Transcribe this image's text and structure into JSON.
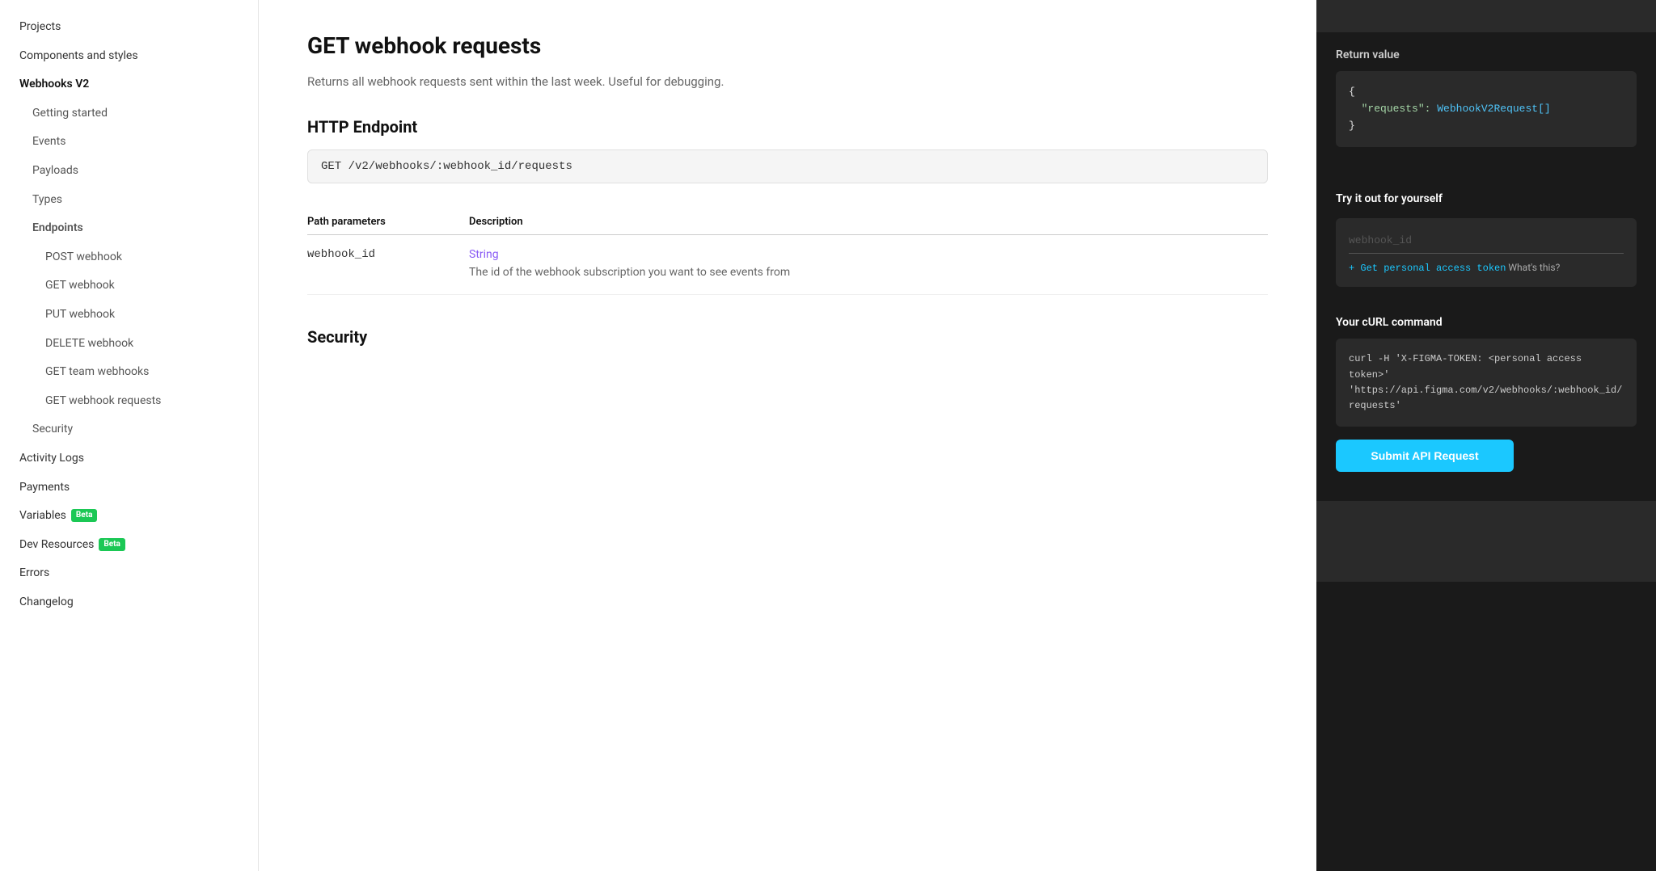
{
  "sidebar": {
    "items": [
      {
        "id": "projects",
        "label": "Projects",
        "level": "top"
      },
      {
        "id": "components-and-styles",
        "label": "Components and styles",
        "level": "top"
      },
      {
        "id": "webhooks-v2",
        "label": "Webhooks V2",
        "level": "top",
        "bold": true
      },
      {
        "id": "getting-started",
        "label": "Getting started",
        "level": "sub"
      },
      {
        "id": "events",
        "label": "Events",
        "level": "sub"
      },
      {
        "id": "payloads",
        "label": "Payloads",
        "level": "sub"
      },
      {
        "id": "types",
        "label": "Types",
        "level": "sub"
      },
      {
        "id": "endpoints",
        "label": "Endpoints",
        "level": "sub",
        "active": true
      },
      {
        "id": "post-webhook",
        "label": "POST webhook",
        "level": "subsub"
      },
      {
        "id": "get-webhook",
        "label": "GET webhook",
        "level": "subsub"
      },
      {
        "id": "put-webhook",
        "label": "PUT webhook",
        "level": "subsub"
      },
      {
        "id": "delete-webhook",
        "label": "DELETE webhook",
        "level": "subsub"
      },
      {
        "id": "get-team-webhooks",
        "label": "GET team webhooks",
        "level": "subsub"
      },
      {
        "id": "get-webhook-requests",
        "label": "GET webhook requests",
        "level": "subsub",
        "active": false
      },
      {
        "id": "security",
        "label": "Security",
        "level": "sub"
      },
      {
        "id": "activity-logs",
        "label": "Activity Logs",
        "level": "top"
      },
      {
        "id": "payments",
        "label": "Payments",
        "level": "top"
      },
      {
        "id": "variables",
        "label": "Variables",
        "level": "top",
        "badge": "Beta"
      },
      {
        "id": "dev-resources",
        "label": "Dev Resources",
        "level": "top",
        "badge": "Beta"
      },
      {
        "id": "errors",
        "label": "Errors",
        "level": "top"
      },
      {
        "id": "changelog",
        "label": "Changelog",
        "level": "top"
      }
    ]
  },
  "main": {
    "title": "GET webhook requests",
    "description": "Returns all webhook requests sent within the last week. Useful for debugging.",
    "http_endpoint_label": "HTTP Endpoint",
    "endpoint": "GET /v2/webhooks/:webhook_id/requests",
    "path_params_label": "Path parameters",
    "description_col_label": "Description",
    "params": [
      {
        "name": "webhook_id",
        "type": "String",
        "description": "The id of the webhook subscription you want to see events from"
      }
    ],
    "security_label": "Security"
  },
  "right_panel": {
    "return_value_label": "Return value",
    "return_value_code": "{\n  \"requests\": WebhookV2Request[]\n}",
    "requests_key": "\"requests\":",
    "requests_value": "WebhookV2Request[]",
    "try_it_label": "Try it out for yourself",
    "webhook_id_placeholder": "webhook_id",
    "get_token_prefix": "+ ",
    "get_token_link": "Get personal access token",
    "get_token_suffix": " What's this?",
    "curl_label": "Your cURL command",
    "curl_command": "curl -H 'X-FIGMA-TOKEN: <personal access\ntoken>'\n'https://api.figma.com/v2/webhooks/:webhook_id/\nrequests'",
    "submit_label": "Submit API Request"
  }
}
